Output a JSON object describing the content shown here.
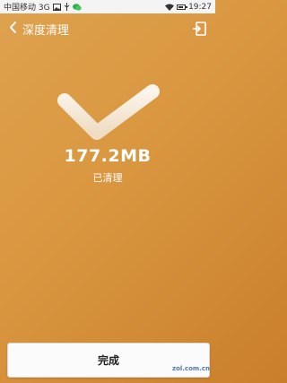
{
  "status_bar": {
    "carrier": "中国移动 3G",
    "time": "19:27",
    "icons": [
      "image-icon",
      "usb-icon",
      "wechat-icon",
      "wifi-icon",
      "battery-icon"
    ]
  },
  "header": {
    "title": "深度清理",
    "back_icon": "chevron-left-icon",
    "shortcut_icon": "shortcut-icon"
  },
  "result": {
    "amount": "177.2MB",
    "caption": "已清理"
  },
  "footer": {
    "done_label": "完成"
  },
  "watermark": {
    "text": "zol.com.cn"
  },
  "colors": {
    "background": "#d9963f",
    "check": "#f6ecdf",
    "button_bg": "#fbfbfb"
  }
}
